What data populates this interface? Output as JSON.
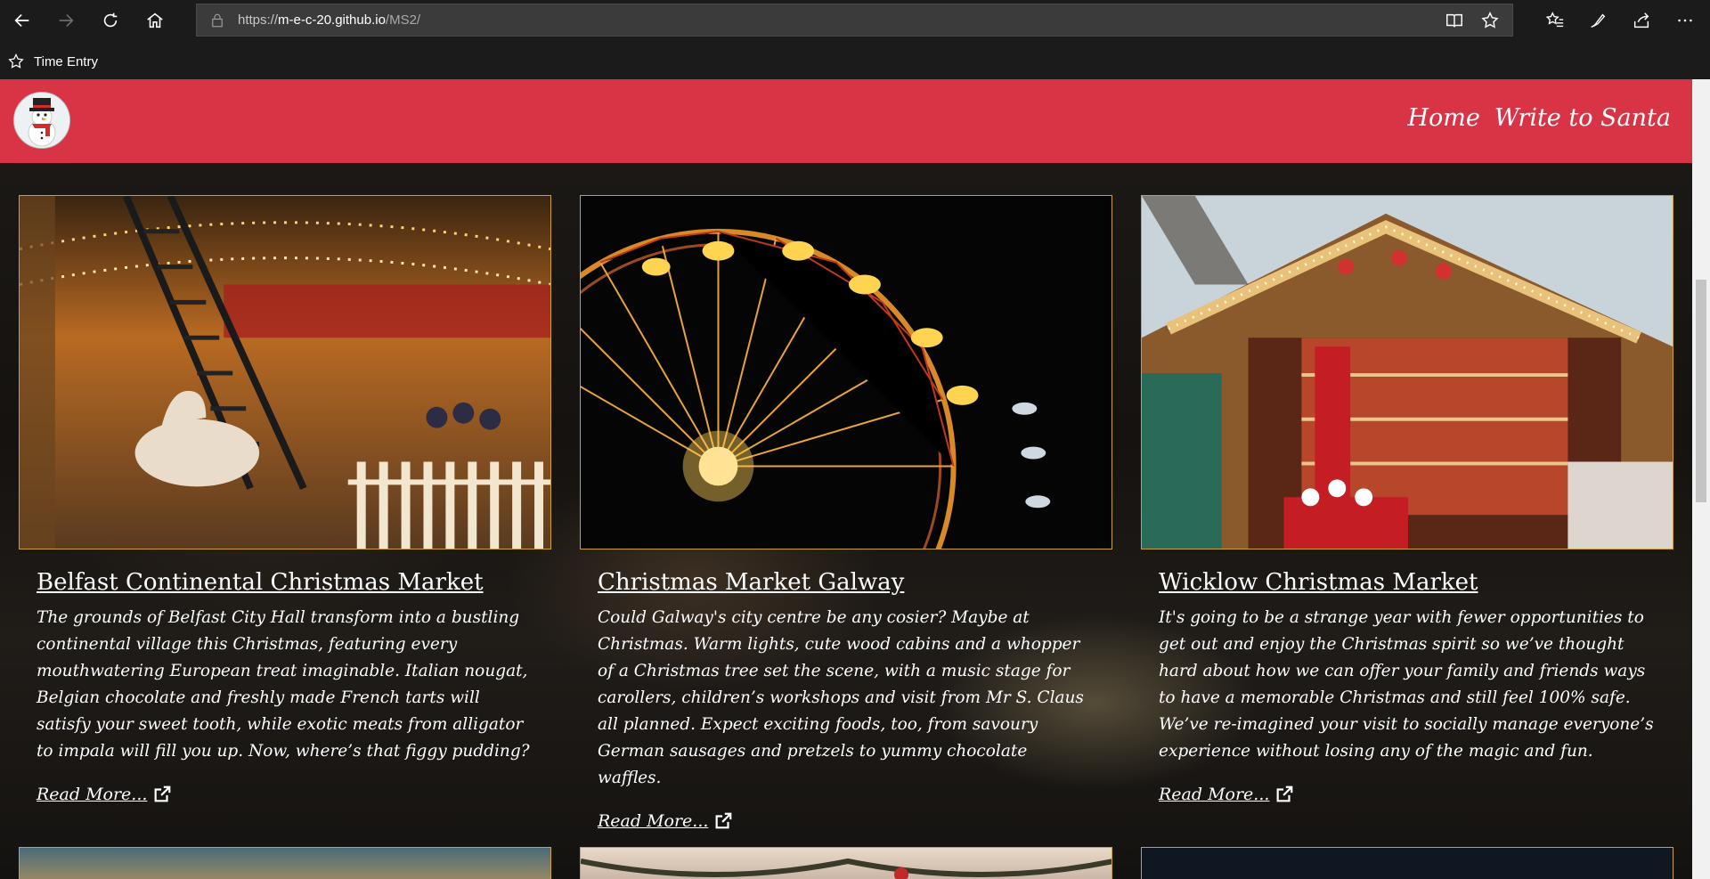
{
  "browser": {
    "url_prefix": "https://",
    "url_host": "m-e-c-20.github.io",
    "url_path": "/MS2/",
    "favorites": [
      {
        "label": "Time Entry"
      }
    ],
    "icons": [
      "back-icon",
      "forward-icon",
      "refresh-icon",
      "home-icon",
      "lock-icon",
      "reading-view-icon",
      "favorite-star-icon",
      "favorites-list-icon",
      "pen-icon",
      "share-icon",
      "more-icon"
    ]
  },
  "nav": {
    "links": [
      {
        "label": "Home"
      },
      {
        "label": "Write to Santa"
      }
    ]
  },
  "cards": [
    {
      "title": "Belfast Continental Christmas Market",
      "text": "The grounds of Belfast City Hall transform into a bustling continental village this Christmas, featuring every mouthwatering European treat imaginable. Italian nougat, Belgian chocolate and freshly made French tarts will satisfy your sweet tooth, while exotic meats from alligator to impala will fill you up. Now, where’s that figgy pudding?",
      "link": "Read More..."
    },
    {
      "title": "Christmas Market Galway",
      "text": "Could Galway's city centre be any cosier? Maybe at Christmas. Warm lights, cute wood cabins and a whopper of a Christmas tree set the scene, with a music stage for carollers, children’s workshops and visit from Mr S. Claus all planned. Expect exciting foods, too, from savoury German sausages and pretzels to yummy chocolate waffles.",
      "link": "Read More..."
    },
    {
      "title": "Wicklow Christmas Market",
      "text": "It's going to be a strange year with fewer opportunities to get out and enjoy the Christmas spirit so we’ve thought hard about how we can offer your family and friends ways to have a memorable Christmas and still feel 100% safe. We’ve re-imagined your visit to socially manage everyone’s experience without losing any of the magic and fun.",
      "link": "Read More..."
    }
  ],
  "colors": {
    "navbar": "#d93446",
    "card_border": "#c9a227",
    "chrome": "#1b1b1b"
  }
}
